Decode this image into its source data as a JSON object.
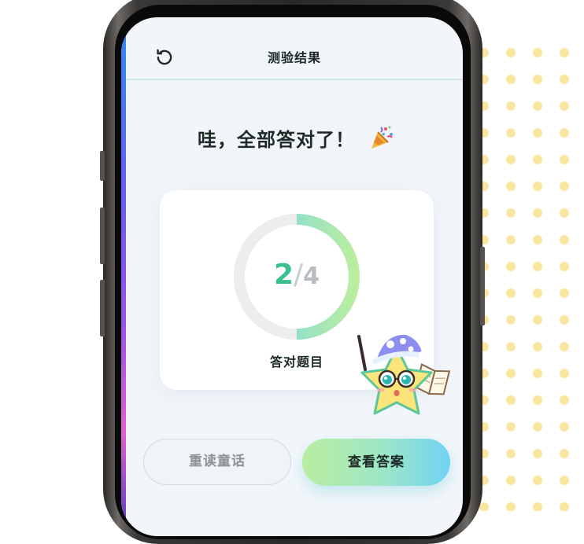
{
  "header": {
    "title": "测验结果"
  },
  "result": {
    "headline": "哇，全部答对了！",
    "correct": "2",
    "separator": "/",
    "total": "4",
    "label": "答对题目",
    "progress_fraction": 0.5
  },
  "actions": {
    "reread_label": "重读童话",
    "view_answers_label": "查看答案"
  },
  "icons": {
    "back": "refresh-icon",
    "celebration": "party-popper-icon",
    "mascot": "star-mascot-illustration"
  },
  "colors": {
    "accent_green": "#3cbf8f",
    "ring_start": "#6fd3f2",
    "ring_end": "#b9eea0",
    "ring_track": "#ebedef",
    "background": "#f2f6fa"
  }
}
